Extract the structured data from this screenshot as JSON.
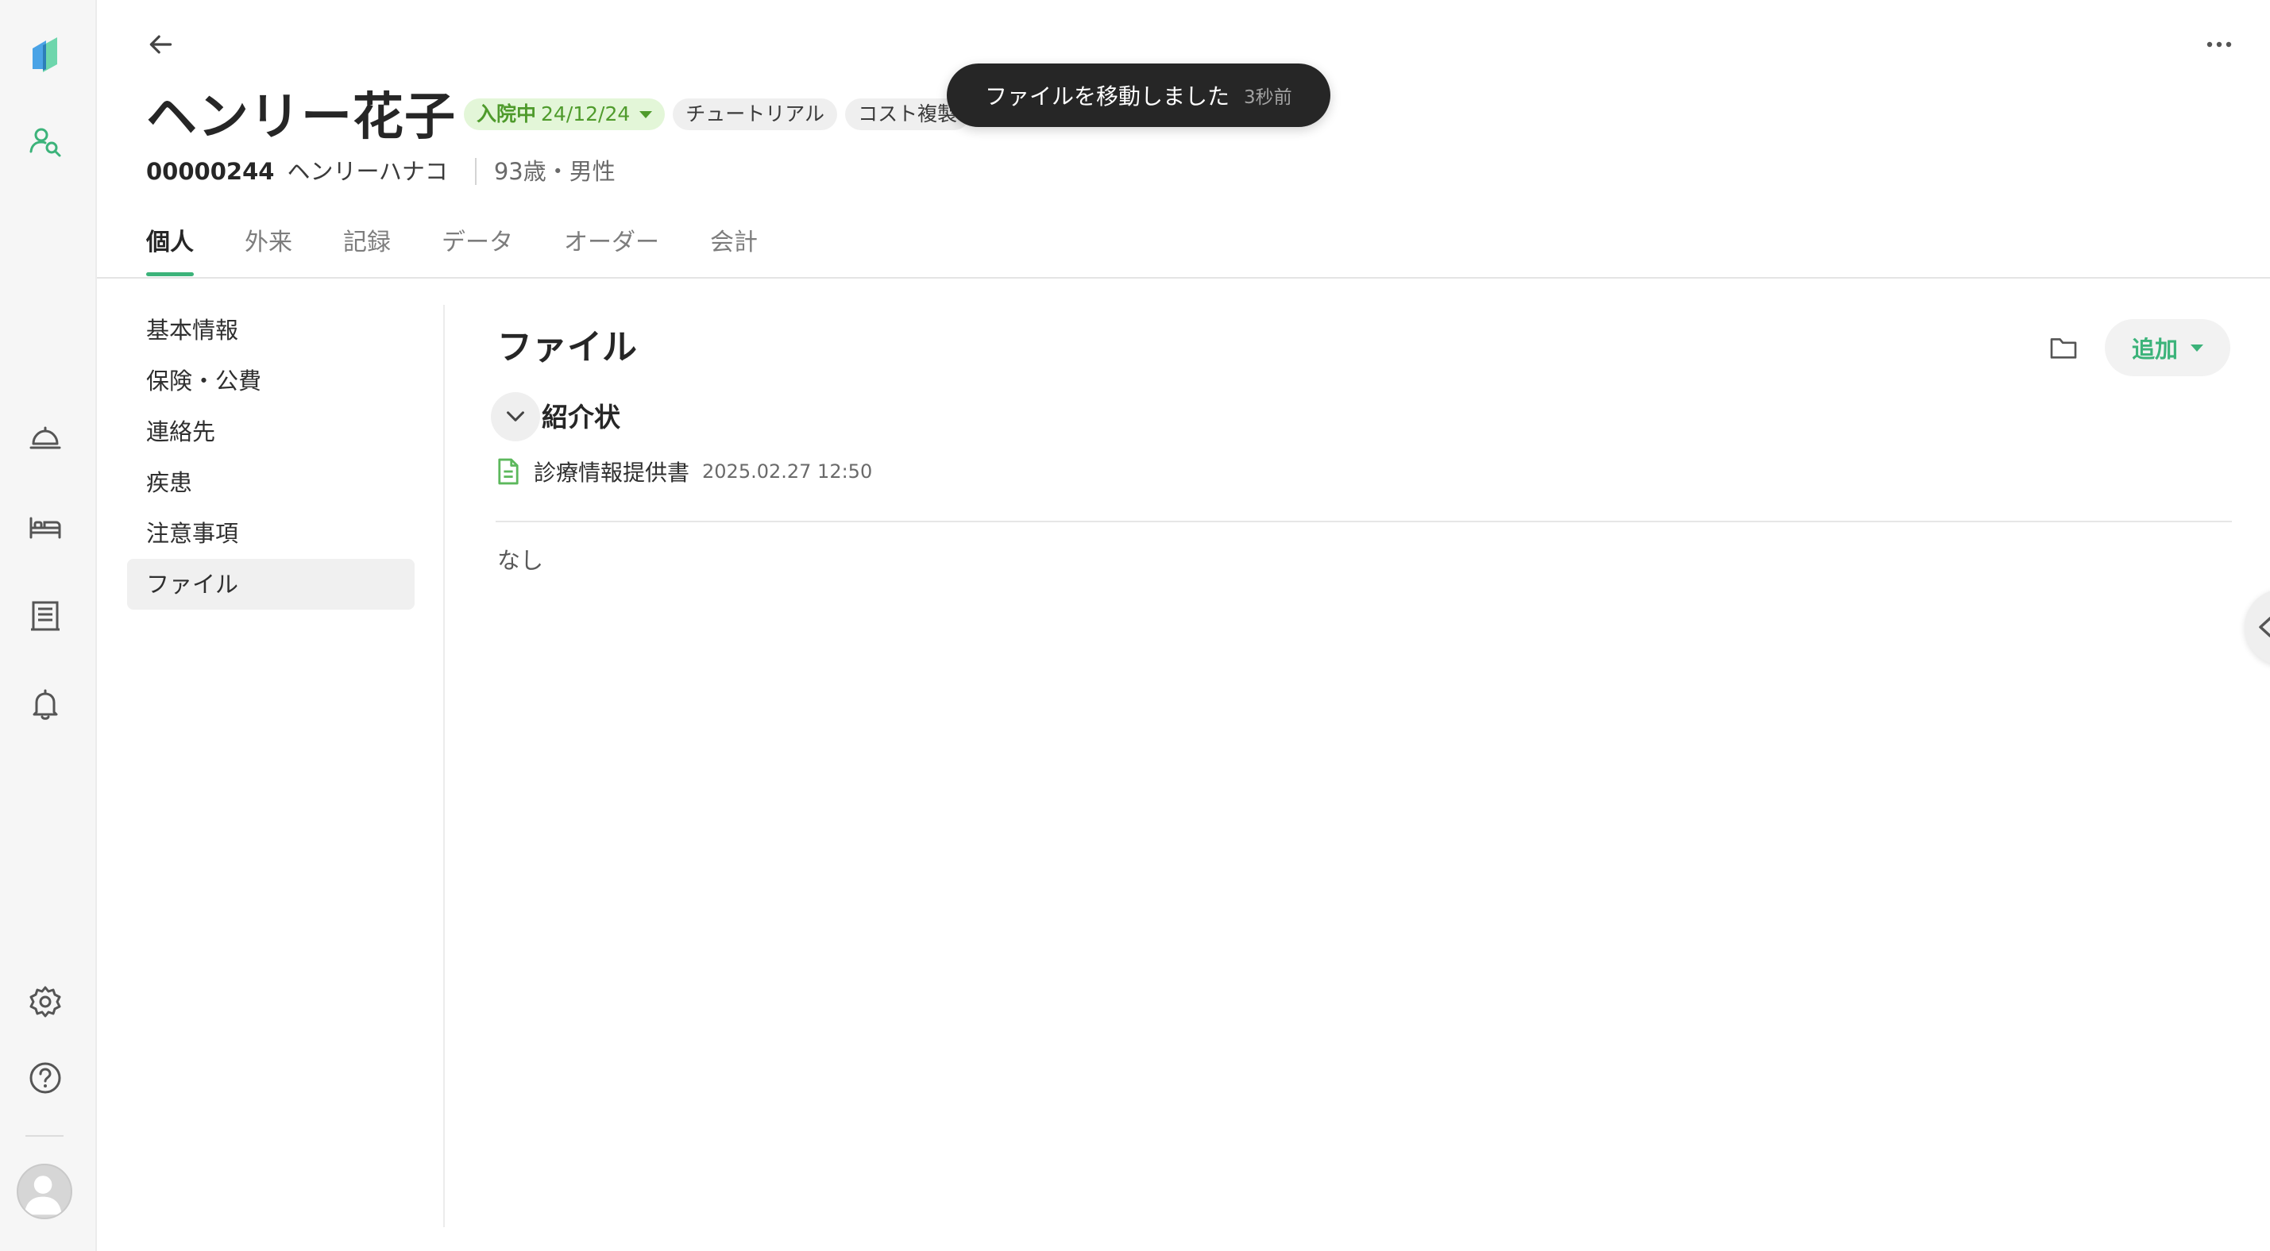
{
  "colors": {
    "accent": "#3cb37a",
    "status_chip_bg": "#e3f6d8",
    "status_chip_text": "#4f9b2c",
    "toast_bg": "#262626"
  },
  "rail": {
    "icons": [
      "logo-icon",
      "patient-search-icon",
      "reception-bell-icon",
      "bed-icon",
      "list-icon",
      "notification-bell-icon",
      "gear-icon",
      "help-icon",
      "avatar"
    ]
  },
  "header": {
    "patient_name": "ヘンリー花子",
    "status_chip": {
      "label": "入院中",
      "date": "24/12/24"
    },
    "tags": [
      "チュートリアル",
      "コスト複製"
    ],
    "patient_id": "00000244",
    "kana": "ヘンリーハナコ",
    "age_sex": "93歳・男性"
  },
  "toast": {
    "message": "ファイルを移動しました",
    "time": "3秒前"
  },
  "tabs": [
    {
      "label": "個人",
      "active": true
    },
    {
      "label": "外来",
      "active": false
    },
    {
      "label": "記録",
      "active": false
    },
    {
      "label": "データ",
      "active": false
    },
    {
      "label": "オーダー",
      "active": false
    },
    {
      "label": "会計",
      "active": false
    }
  ],
  "side_menu": [
    {
      "label": "基本情報",
      "active": false
    },
    {
      "label": "保険・公費",
      "active": false
    },
    {
      "label": "連絡先",
      "active": false
    },
    {
      "label": "疾患",
      "active": false
    },
    {
      "label": "注意事項",
      "active": false
    },
    {
      "label": "ファイル",
      "active": true
    }
  ],
  "main": {
    "title": "ファイル",
    "add_label": "追加",
    "group": {
      "title": "紹介状",
      "files": [
        {
          "name": "診療情報提供書",
          "date": "2025.02.27 12:50"
        }
      ]
    },
    "empty_text": "なし"
  }
}
